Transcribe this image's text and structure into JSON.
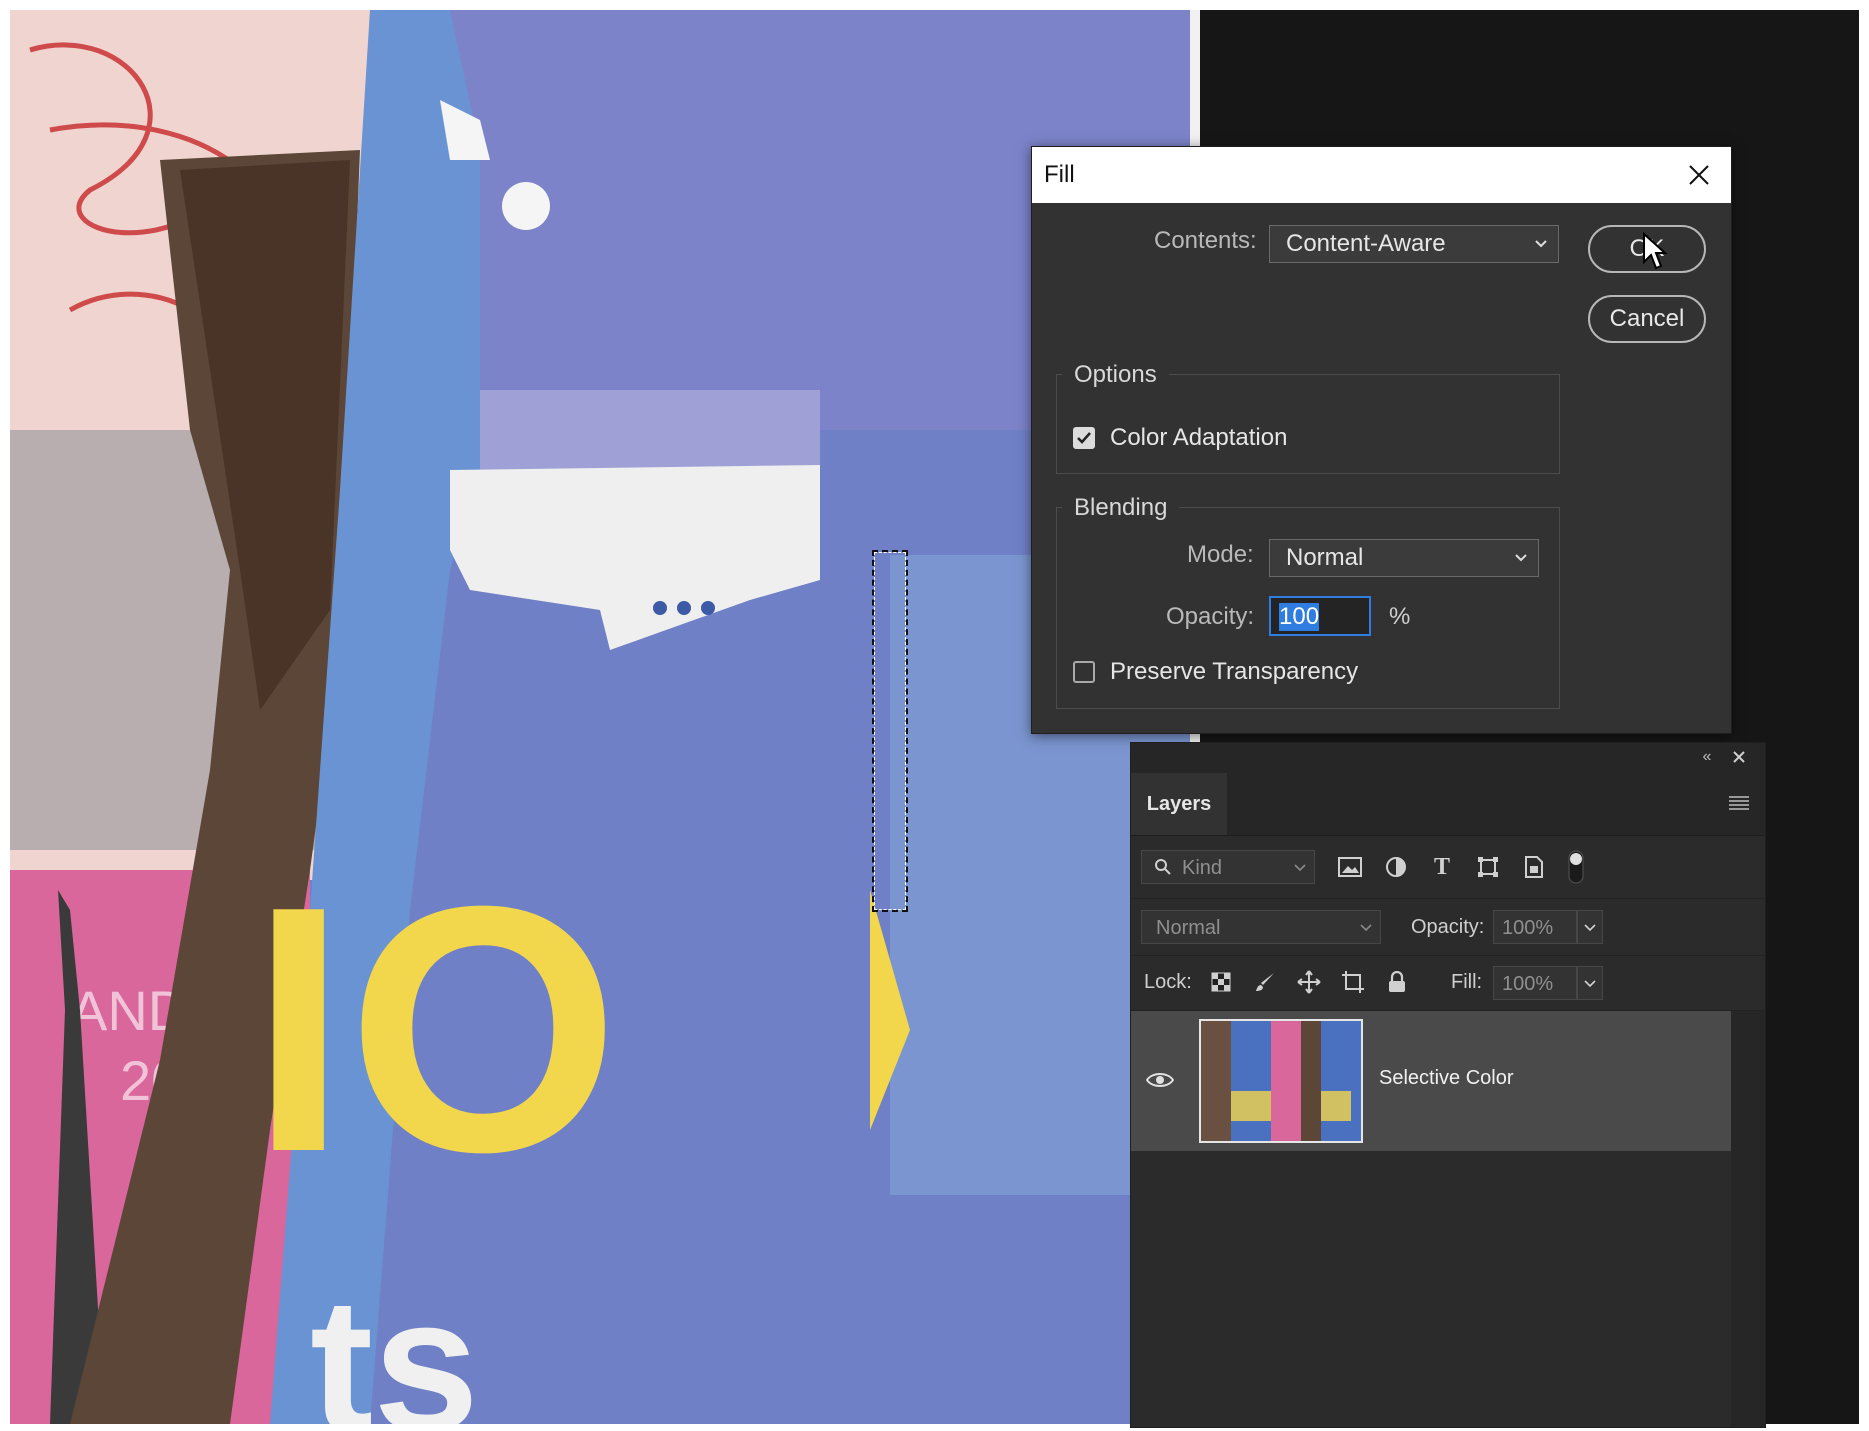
{
  "canvas": {
    "artwork_text": {
      "big_word": "IO",
      "small_word": "ts",
      "pink_text_1": "AND",
      "pink_text_2": "20"
    }
  },
  "fill_dialog": {
    "title": "Fill",
    "contents_label": "Contents:",
    "contents_value": "Content-Aware",
    "ok_label": "OK",
    "cancel_label": "Cancel",
    "options_title": "Options",
    "color_adaptation_label": "Color Adaptation",
    "color_adaptation_checked": true,
    "blending_title": "Blending",
    "mode_label": "Mode:",
    "mode_value": "Normal",
    "opacity_label": "Opacity:",
    "opacity_value": "100",
    "opacity_unit": "%",
    "preserve_transparency_label": "Preserve Transparency",
    "preserve_transparency_checked": false
  },
  "layers_panel": {
    "tab_label": "Layers",
    "filter_placeholder": "Kind",
    "blend_mode": "Normal",
    "opacity_label": "Opacity:",
    "opacity_value": "100%",
    "lock_label": "Lock:",
    "fill_label": "Fill:",
    "fill_value": "100%",
    "layers": [
      {
        "name": "Selective Color",
        "visible": true
      }
    ]
  },
  "colors": {
    "dialog_bg": "#323232",
    "accent_blue": "#2f7de1",
    "canvas_blue": "#6f7fc4",
    "yellow": "#f2d64b",
    "pink": "#d9679b"
  }
}
